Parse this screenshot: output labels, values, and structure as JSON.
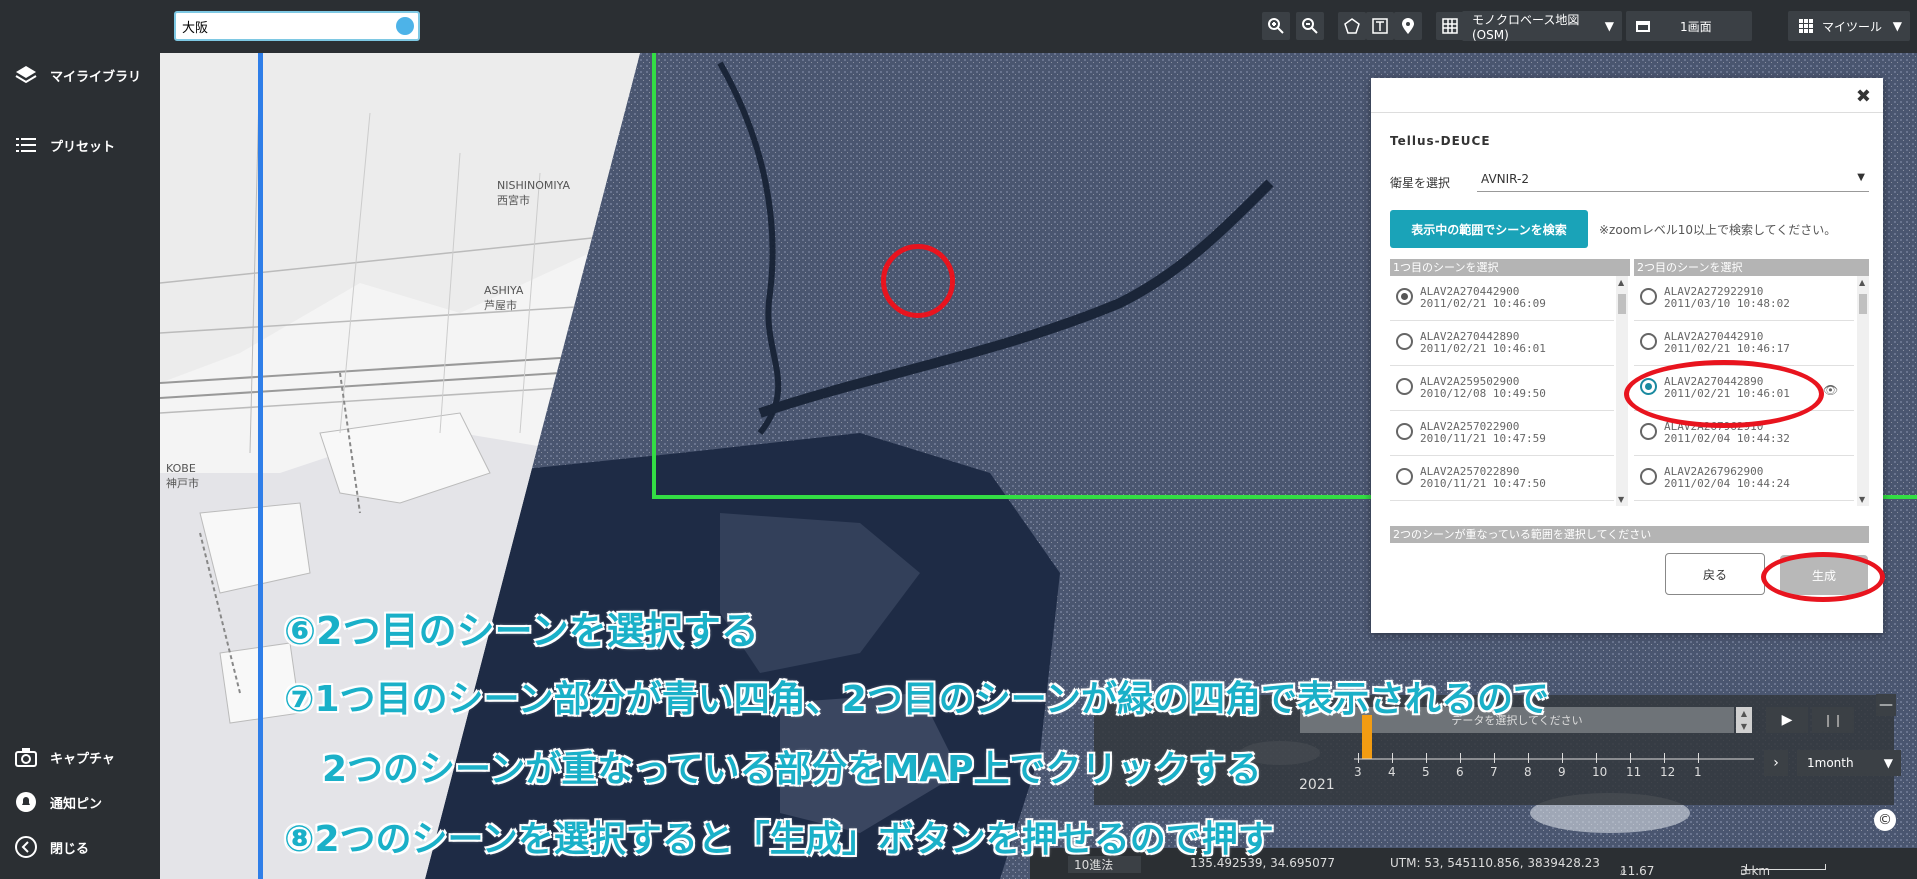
{
  "sidebar": {
    "library": "マイライブラリ",
    "preset": "プリセット",
    "capture": "キャプチャ",
    "notify_pin": "通知ピン",
    "close": "閉じる"
  },
  "topbar": {
    "search_value": "大阪",
    "basemap": "モノクロベース地図(OSM)",
    "screen": "1画面",
    "mytools": "マイツール"
  },
  "map": {
    "labels": {
      "nishinomiya_en": "NISHINOMIYA",
      "nishinomiya_jp": "西宮市",
      "ashiya_en": "ASHIYA",
      "ashiya_jp": "芦屋市",
      "kobe_en": "KOBE",
      "kobe_jp": "神戸市"
    }
  },
  "dialog": {
    "title": "Tellus-DEUCE",
    "satellite_label": "衛星を選択",
    "satellite_value": "AVNIR-2",
    "search_button": "表示中の範囲でシーンを検索",
    "note": "※zoomレベル10以上で検索してください。",
    "col1_header": "1つ目のシーンを選択",
    "col2_header": "2つ目のシーンを選択",
    "scenes1": [
      {
        "id": "ALAV2A270442900",
        "date": "2011/02/21 10:46:09"
      },
      {
        "id": "ALAV2A270442890",
        "date": "2011/02/21 10:46:01"
      },
      {
        "id": "ALAV2A259502900",
        "date": "2010/12/08 10:49:50"
      },
      {
        "id": "ALAV2A257022900",
        "date": "2010/11/21 10:47:59"
      },
      {
        "id": "ALAV2A257022890",
        "date": "2010/11/21 10:47:50"
      }
    ],
    "scenes2": [
      {
        "id": "ALAV2A272922910",
        "date": "2011/03/10 10:48:02"
      },
      {
        "id": "ALAV2A270442910",
        "date": "2011/02/21 10:46:17"
      },
      {
        "id": "ALAV2A270442890",
        "date": "2011/02/21 10:46:01"
      },
      {
        "id": "ALAV2A267962910",
        "date": "2011/02/04 10:44:32"
      },
      {
        "id": "ALAV2A267962900",
        "date": "2011/02/04 10:44:24"
      }
    ],
    "footer": "2つのシーンが重なっている範囲を選択してください",
    "back_button": "戻る",
    "generate_button": "生成"
  },
  "timeline": {
    "message": "データを選択してください",
    "year": "2021",
    "months": [
      "3",
      "4",
      "5",
      "6",
      "7",
      "8",
      "9",
      "10",
      "11",
      "12",
      "1"
    ],
    "interval": "1month",
    "play": "▶",
    "pause": "❙❙",
    "minimize": "—"
  },
  "statusbar": {
    "zoom_mode": "10進法",
    "lonlat": "135.492539, 34.695077",
    "utm": "UTM: 53, 545110.856, 3839428.23",
    "zoom": "11.67",
    "scale": "3 km"
  },
  "instructions": {
    "step6": "⑥2つ目のシーンを選択する",
    "step7a": "⑦1つ目のシーン部分が青い四角、2つ目のシーンが緑の四角で表示されるので",
    "step7b": "2つのシーンが重なっている部分をMAP上でクリックする",
    "step8": "⑧2つのシーンを選択すると「生成」ボタンを押せるので押す"
  },
  "colors": {
    "sidebar_bg": "#2b2f33",
    "accent_teal": "#1aa3b8",
    "annotation_red": "#e8141e",
    "scene1_rect": "#2f7ee8",
    "scene2_rect": "#33dd44",
    "instruction_text": "#1ab0c8"
  }
}
